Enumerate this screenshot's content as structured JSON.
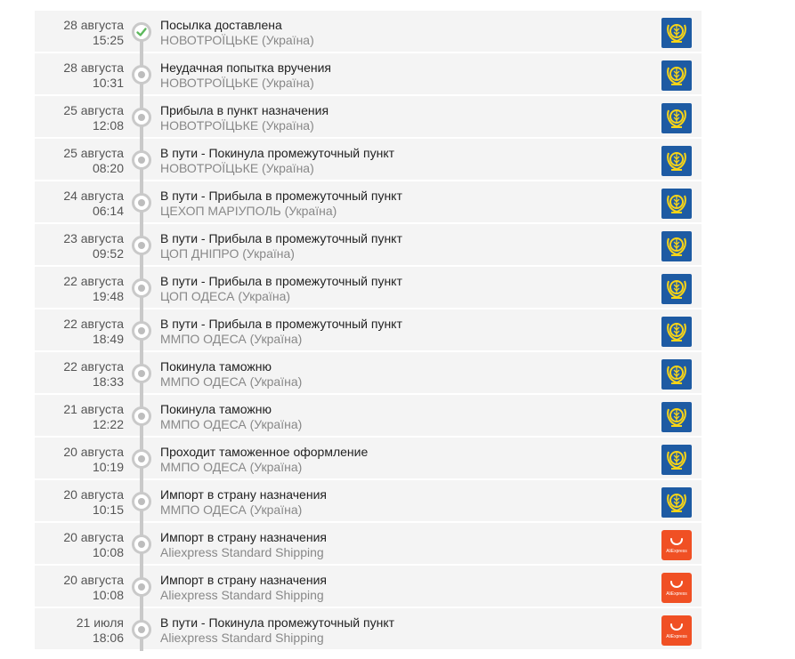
{
  "events": [
    {
      "date": "28 августа",
      "time": "15:25",
      "status": "Посылка доставлена",
      "place": "НОВОТРОЇЦЬКЕ (Україна)",
      "carrier": "ukrposhta",
      "delivered": true
    },
    {
      "date": "28 августа",
      "time": "10:31",
      "status": "Неудачная попытка вручения",
      "place": "НОВОТРОЇЦЬКЕ (Україна)",
      "carrier": "ukrposhta"
    },
    {
      "date": "25 августа",
      "time": "12:08",
      "status": "Прибыла в пункт назначения",
      "place": "НОВОТРОЇЦЬКЕ (Україна)",
      "carrier": "ukrposhta"
    },
    {
      "date": "25 августа",
      "time": "08:20",
      "status": "В пути - Покинула промежуточный пункт",
      "place": "НОВОТРОЇЦЬКЕ (Україна)",
      "carrier": "ukrposhta"
    },
    {
      "date": "24 августа",
      "time": "06:14",
      "status": "В пути - Прибыла в промежуточный пункт",
      "place": "ЦЕХОП МАРІУПОЛЬ (Україна)",
      "carrier": "ukrposhta"
    },
    {
      "date": "23 августа",
      "time": "09:52",
      "status": "В пути - Прибыла в промежуточный пункт",
      "place": "ЦОП ДНІПРО (Україна)",
      "carrier": "ukrposhta"
    },
    {
      "date": "22 августа",
      "time": "19:48",
      "status": "В пути - Прибыла в промежуточный пункт",
      "place": "ЦОП ОДЕСА (Україна)",
      "carrier": "ukrposhta"
    },
    {
      "date": "22 августа",
      "time": "18:49",
      "status": "В пути - Прибыла в промежуточный пункт",
      "place": "ММПО ОДЕСА (Україна)",
      "carrier": "ukrposhta"
    },
    {
      "date": "22 августа",
      "time": "18:33",
      "status": "Покинула таможню",
      "place": "ММПО ОДЕСА (Україна)",
      "carrier": "ukrposhta"
    },
    {
      "date": "21 августа",
      "time": "12:22",
      "status": "Покинула таможню",
      "place": "ММПО ОДЕСА (Україна)",
      "carrier": "ukrposhta"
    },
    {
      "date": "20 августа",
      "time": "10:19",
      "status": "Проходит таможенное оформление",
      "place": "ММПО ОДЕСА (Україна)",
      "carrier": "ukrposhta"
    },
    {
      "date": "20 августа",
      "time": "10:15",
      "status": "Импорт в страну назначения",
      "place": "ММПО ОДЕСА (Україна)",
      "carrier": "ukrposhta"
    },
    {
      "date": "20 августа",
      "time": "10:08",
      "status": "Импорт в страну назначения",
      "place": "Aliexpress Standard Shipping",
      "carrier": "aliexpress"
    },
    {
      "date": "20 августа",
      "time": "10:08",
      "status": "Импорт в страну назначения",
      "place": "Aliexpress Standard Shipping",
      "carrier": "aliexpress"
    },
    {
      "date": "21 июля",
      "time": "18:06",
      "status": "В пути - Покинула промежуточный пункт",
      "place": "Aliexpress Standard Shipping",
      "carrier": "aliexpress"
    }
  ],
  "logos": {
    "aliexpress_text": "AliExpress"
  },
  "colors": {
    "ukrposhta_blue": "#1e5ba3",
    "ukrposhta_gold": "#f7d417",
    "aliexpress_orange": "#f05024",
    "delivered_check": "#5cb85c",
    "timeline_gray": "#c9c9c9"
  },
  "icons": {
    "ukrposhta": "ukrposhta-logo-icon",
    "aliexpress": "aliexpress-logo-icon",
    "delivered": "check-circle-icon",
    "step": "timeline-dot-icon"
  }
}
